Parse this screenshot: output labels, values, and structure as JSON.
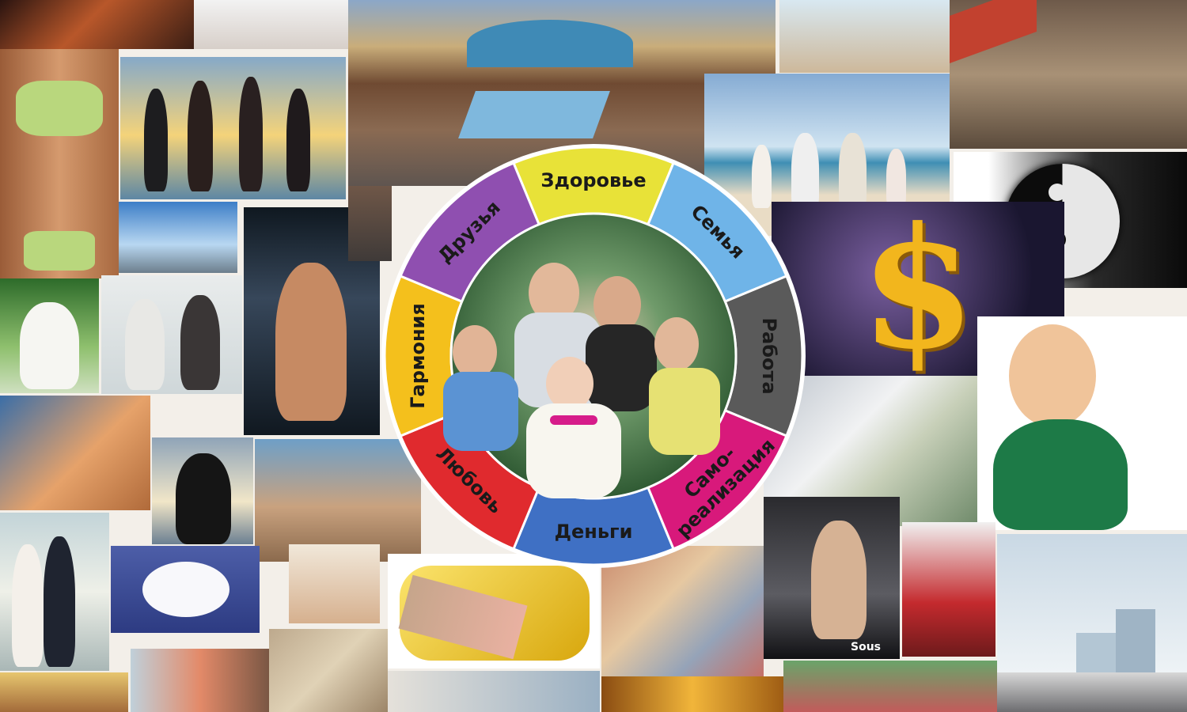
{
  "wheel": {
    "segments": [
      {
        "label": "Здоровье",
        "color": "#e8e238"
      },
      {
        "label": "Семья",
        "color": "#6fb4e8"
      },
      {
        "label": "Работа",
        "color": "#5a5a5a"
      },
      {
        "label": "Само-",
        "label2": "реализация",
        "color": "#d8197b"
      },
      {
        "label": "Деньги",
        "color": "#3f70c4"
      },
      {
        "label": "Любовь",
        "color": "#e02a2e"
      },
      {
        "label": "Гармония",
        "color": "#f4c01c"
      },
      {
        "label": "Друзья",
        "color": "#8f4fb0"
      }
    ]
  },
  "watermark": "Sous",
  "colors": {
    "background": "#f3efe9",
    "rim": "#ffffff"
  }
}
